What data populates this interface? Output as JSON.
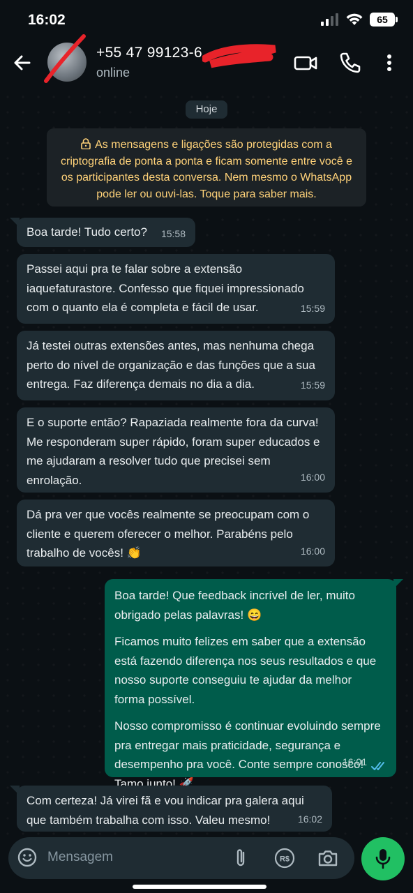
{
  "status_bar": {
    "time": "16:02",
    "battery": "65"
  },
  "header": {
    "contact_name": "+55 47 99123-6",
    "status": "online"
  },
  "chat": {
    "date_chip": "Hoje",
    "encryption_notice": "As mensagens e ligações são protegidas com a criptografia de ponta a ponta e ficam somente entre você e os participantes desta conversa. Nem mesmo o WhatsApp pode ler ou ouvi-las. Toque para saber mais.",
    "messages": [
      {
        "direction": "in",
        "text": "Boa tarde! Tudo certo?",
        "time": "15:58"
      },
      {
        "direction": "in",
        "text": "Passei aqui pra te falar sobre a extensão iaquefaturastore. Confesso que fiquei impressionado com o quanto ela é completa e fácil de usar.",
        "time": "15:59"
      },
      {
        "direction": "in",
        "text": "Já testei outras extensões antes, mas nenhuma chega perto do nível de organização e das funções que a sua entrega. Faz diferença demais no dia a dia.",
        "time": "15:59"
      },
      {
        "direction": "in",
        "text": "E o suporte então? Rapaziada realmente fora da curva! Me responderam super rápido, foram super educados e me ajudaram a resolver tudo que precisei sem enrolação.",
        "time": "16:00"
      },
      {
        "direction": "in",
        "text": "Dá pra ver que vocês realmente se preocupam com o cliente e querem oferecer o melhor. Parabéns pelo trabalho de vocês! 👏",
        "time": "16:00"
      },
      {
        "direction": "out",
        "paragraphs": [
          "Boa tarde! Que feedback incrível de ler, muito obrigado pelas palavras! 😄",
          "Ficamos muito felizes em saber que a extensão está fazendo diferença nos seus resultados e que nosso suporte conseguiu te ajudar da melhor forma possível.",
          "Nosso compromisso é continuar evoluindo sempre pra entregar mais praticidade, segurança e desempenho pra você. Conte sempre conosco! Tamo junto! 🚀"
        ],
        "time": "16:01",
        "read_status": "read"
      },
      {
        "direction": "in",
        "text": "Com certeza! Já virei fã e vou indicar pra galera aqui que também trabalha com isso. Valeu mesmo!",
        "time": "16:02"
      }
    ]
  },
  "composer": {
    "placeholder": "Mensagem"
  },
  "colors": {
    "background": "#0b1014",
    "incoming_bubble": "#1f2c33",
    "outgoing_bubble": "#005c4b",
    "accent_green": "#21c063",
    "read_ticks": "#53bdeb",
    "notice_text": "#ffd279"
  }
}
